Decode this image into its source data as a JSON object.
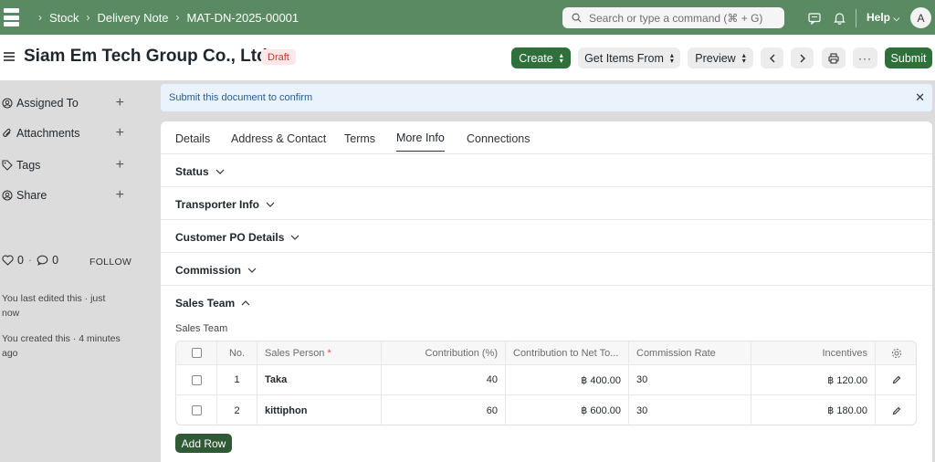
{
  "navbar": {
    "breadcrumbs": [
      "Stock",
      "Delivery Note",
      "MAT-DN-2025-00001"
    ],
    "search_placeholder": "Search or type a command (⌘ + G)",
    "help_label": "Help",
    "avatar_initial": "A"
  },
  "header": {
    "title": "Siam Em Tech Group Co., Ltd.",
    "status": "Draft",
    "create_label": "Create",
    "get_items_label": "Get Items From",
    "preview_label": "Preview",
    "submit_label": "Submit"
  },
  "sidebar": {
    "items": [
      {
        "label": "Assigned To",
        "icon": "assign-icon"
      },
      {
        "label": "Attachments",
        "icon": "paperclip-icon"
      },
      {
        "label": "Tags",
        "icon": "tag-icon"
      },
      {
        "label": "Share",
        "icon": "share-icon"
      }
    ],
    "likes": "0",
    "comments": "0",
    "follow_label": "FOLLOW",
    "edited_note": "You last edited this · just now",
    "created_note": "You created this · 4 minutes ago"
  },
  "alert": {
    "message": "Submit this document to confirm"
  },
  "tabs": [
    "Details",
    "Address & Contact",
    "Terms",
    "More Info",
    "Connections"
  ],
  "active_tab": "More Info",
  "sections": [
    "Status",
    "Transporter Info",
    "Customer PO Details",
    "Commission",
    "Sales Team"
  ],
  "sales_team": {
    "label": "Sales Team",
    "columns": [
      "No.",
      "Sales Person",
      "Contribution (%)",
      "Contribution to Net To...",
      "Commission Rate",
      "Incentives"
    ],
    "rows": [
      {
        "no": "1",
        "sales_person": "Taka",
        "contribution": "40",
        "contribution_net": "฿ 400.00",
        "commission_rate": "30",
        "incentives": "฿ 120.00"
      },
      {
        "no": "2",
        "sales_person": "kittiphon",
        "contribution": "60",
        "contribution_net": "฿ 600.00",
        "commission_rate": "30",
        "incentives": "฿ 180.00"
      }
    ],
    "add_row_label": "Add Row"
  },
  "colors": {
    "navbar": "#5a8a62",
    "primary_button": "#2f6f3a",
    "draft_badge": "#c0392b"
  }
}
